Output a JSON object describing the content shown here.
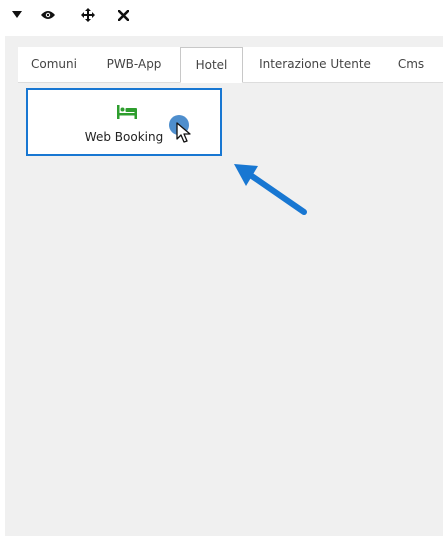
{
  "toolbar": {
    "icons": [
      "caret-down-icon",
      "eye-icon",
      "move-icon",
      "close-icon"
    ]
  },
  "tabs": [
    {
      "label": "Comuni",
      "active": false
    },
    {
      "label": "PWB-App",
      "active": false
    },
    {
      "label": "Hotel",
      "active": true
    },
    {
      "label": "Interazione Utente",
      "active": false
    },
    {
      "label": "Cms",
      "active": false
    }
  ],
  "tile": {
    "label": "Web Booking",
    "icon": "bed-icon"
  },
  "colors": {
    "accent": "#1877d2",
    "icon_green": "#2e9e2e",
    "panel_bg": "#f0f0f0"
  }
}
